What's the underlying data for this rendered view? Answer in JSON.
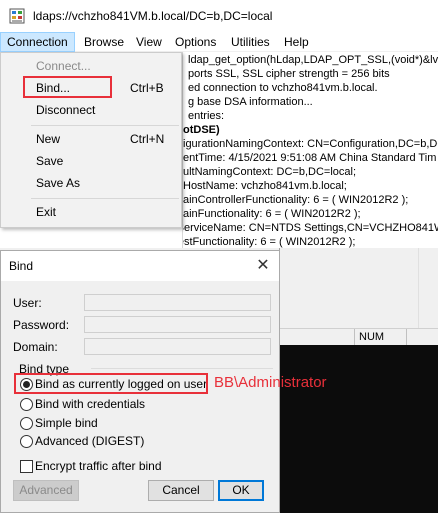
{
  "window": {
    "title": "ldaps://vchzho841VM.b.local/DC=b,DC=local"
  },
  "menubar": {
    "items": [
      "Connection",
      "Browse",
      "View",
      "Options",
      "Utilities",
      "Help"
    ]
  },
  "connection_menu": {
    "items": [
      {
        "label": "Connect...",
        "shortcut": "",
        "enabled": false
      },
      {
        "label": "Bind...",
        "shortcut": "Ctrl+B",
        "enabled": true
      },
      {
        "label": "Disconnect",
        "shortcut": "",
        "enabled": true
      },
      {
        "label": "New",
        "shortcut": "Ctrl+N",
        "enabled": true
      },
      {
        "label": "Save",
        "shortcut": "",
        "enabled": true
      },
      {
        "label": "Save As",
        "shortcut": "",
        "enabled": true
      },
      {
        "label": "Exit",
        "shortcut": "",
        "enabled": true
      }
    ]
  },
  "output": {
    "lines": [
      "ldap_get_option(hLdap,LDAP_OPT_SSL,(void*)&lv",
      "ports SSL, SSL cipher strength = 256 bits",
      "ed connection to vchzho841vm.b.local.",
      "g base DSA information...",
      " entries:",
      "otDSE)",
      "igurationNamingContext: CN=Configuration,DC=b,DC",
      "entTime: 4/15/2021 9:51:08 AM China Standard Tim",
      "ultNamingContext: DC=b,DC=local;",
      "HostName: vchzho841vm.b.local;",
      "ainControllerFunctionality: 6 = ( WIN2012R2 );",
      "ainFunctionality: 6 = ( WIN2012R2 );",
      "dsServiceName: CN=NTDS Settings,CN=VCHZHO841W",
      "forestFunctionality: 6 = ( WIN2012R2 );"
    ]
  },
  "status": {
    "num": "NUM"
  },
  "bind_dialog": {
    "title": "Bind",
    "close_glyph": "✕",
    "user_label": "User:",
    "password_label": "Password:",
    "domain_label": "Domain:",
    "user_value": "",
    "password_value": "",
    "domain_value": "",
    "bind_type_label": "Bind type",
    "bind_types": [
      {
        "label": "Bind as currently logged on user",
        "checked": true
      },
      {
        "label": "Bind with credentials",
        "checked": false
      },
      {
        "label": "Simple bind",
        "checked": false
      },
      {
        "label": "Advanced (DIGEST)",
        "checked": false
      }
    ],
    "encrypt_label": "Encrypt traffic after bind",
    "encrypt_checked": false,
    "advanced_label": "Advanced",
    "cancel_label": "Cancel",
    "ok_label": "OK"
  },
  "annotation": {
    "text": "BB\\Administrator",
    "color": "#e8303a"
  }
}
